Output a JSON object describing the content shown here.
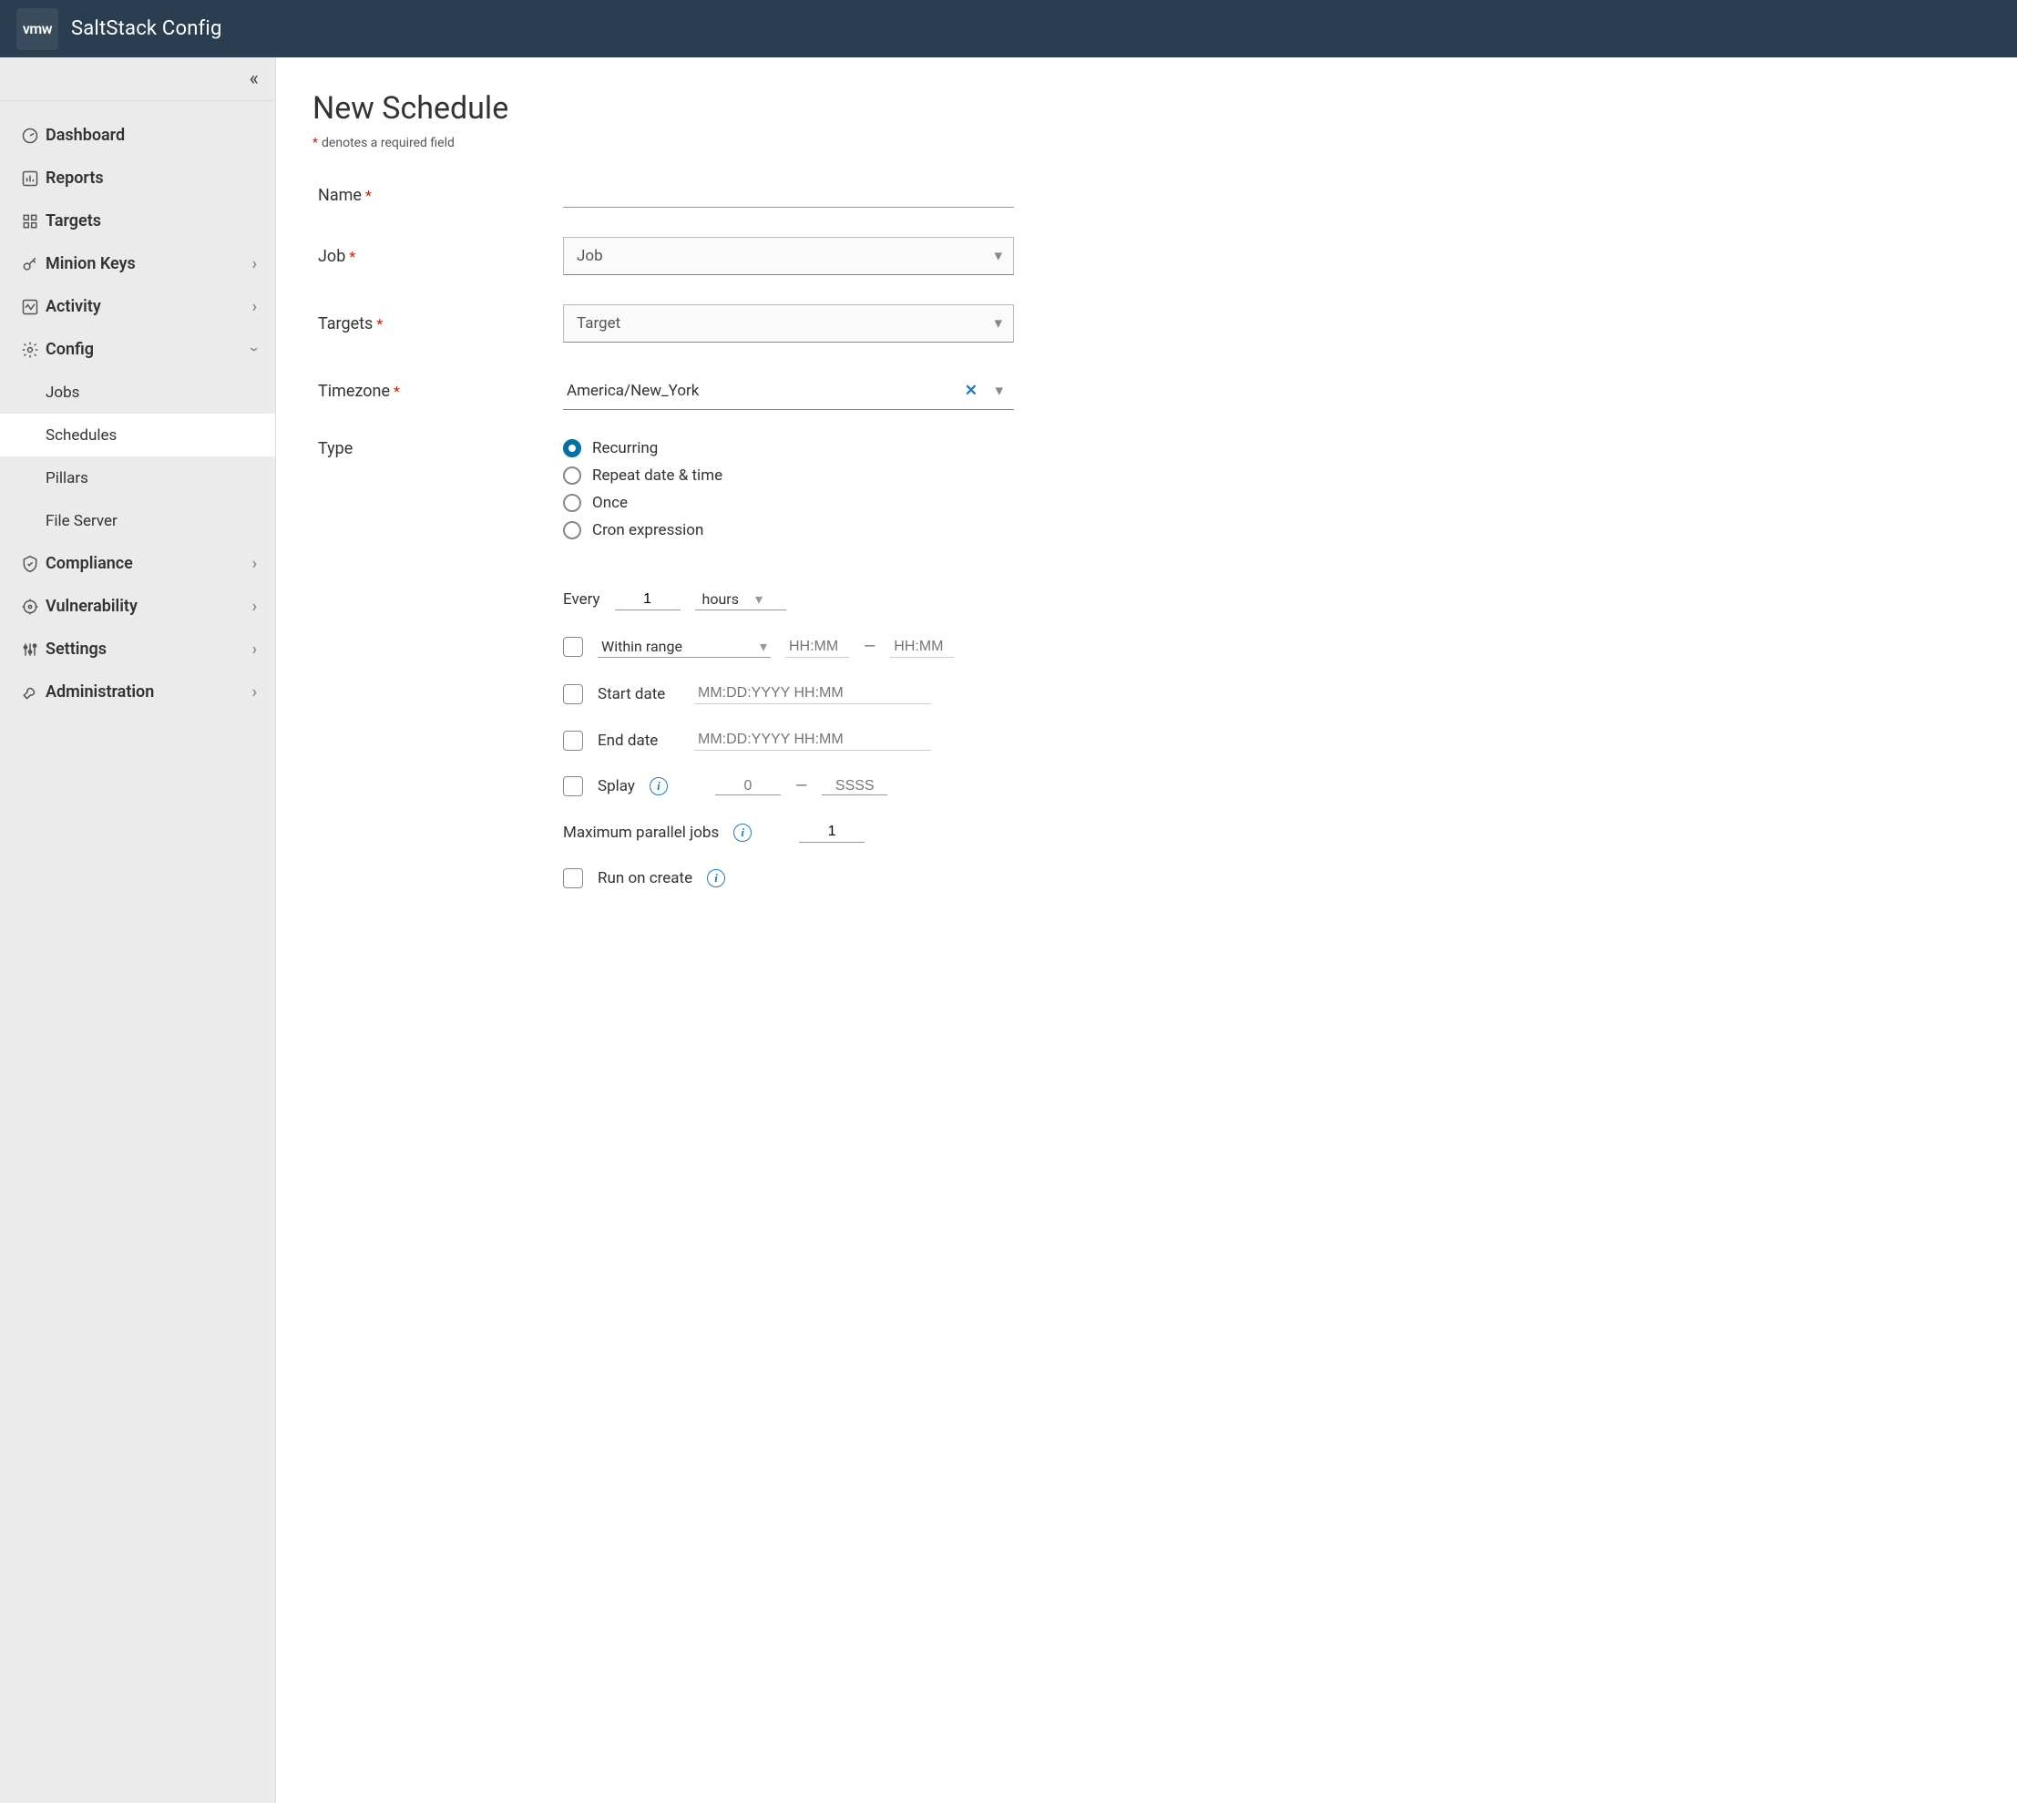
{
  "header": {
    "logo": "vmw",
    "title": "SaltStack Config"
  },
  "sidebar": {
    "items": [
      {
        "key": "dashboard",
        "label": "Dashboard",
        "expandable": false
      },
      {
        "key": "reports",
        "label": "Reports",
        "expandable": false
      },
      {
        "key": "targets",
        "label": "Targets",
        "expandable": false
      },
      {
        "key": "minion-keys",
        "label": "Minion Keys",
        "expandable": true
      },
      {
        "key": "activity",
        "label": "Activity",
        "expandable": true
      },
      {
        "key": "config",
        "label": "Config",
        "expandable": true,
        "expanded": true,
        "children": [
          {
            "key": "jobs",
            "label": "Jobs"
          },
          {
            "key": "schedules",
            "label": "Schedules",
            "active": true
          },
          {
            "key": "pillars",
            "label": "Pillars"
          },
          {
            "key": "file-server",
            "label": "File Server"
          }
        ]
      },
      {
        "key": "compliance",
        "label": "Compliance",
        "expandable": true
      },
      {
        "key": "vulnerability",
        "label": "Vulnerability",
        "expandable": true
      },
      {
        "key": "settings",
        "label": "Settings",
        "expandable": true
      },
      {
        "key": "administration",
        "label": "Administration",
        "expandable": true
      }
    ]
  },
  "page": {
    "title": "New Schedule",
    "required_note": "denotes a required field",
    "asterisk": "*"
  },
  "form": {
    "name": {
      "label": "Name",
      "value": ""
    },
    "job": {
      "label": "Job",
      "placeholder": "Job"
    },
    "targets": {
      "label": "Targets",
      "placeholder": "Target"
    },
    "timezone": {
      "label": "Timezone",
      "value": "America/New_York",
      "clear_symbol": "✕"
    },
    "type": {
      "label": "Type",
      "options": [
        "Recurring",
        "Repeat date & time",
        "Once",
        "Cron expression"
      ],
      "selected": "Recurring"
    },
    "recurring": {
      "every_label": "Every",
      "every_value": "1",
      "unit": "hours",
      "within_range": {
        "label": "Within range",
        "from_placeholder": "HH:MM",
        "to_placeholder": "HH:MM",
        "dash": "—"
      },
      "start_date": {
        "label": "Start date",
        "placeholder": "MM:DD:YYYY HH:MM"
      },
      "end_date": {
        "label": "End date",
        "placeholder": "MM:DD:YYYY HH:MM"
      },
      "splay": {
        "label": "Splay",
        "from_placeholder": "0",
        "to_placeholder": "SSSS",
        "dash": "—"
      },
      "max_parallel": {
        "label": "Maximum parallel jobs",
        "value": "1"
      },
      "run_on_create": {
        "label": "Run on create"
      }
    }
  }
}
